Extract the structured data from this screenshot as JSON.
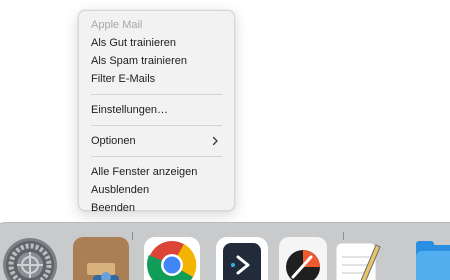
{
  "context_menu": {
    "header": "Apple Mail",
    "items": [
      {
        "label": "Als Gut trainieren"
      },
      {
        "label": "Als Spam trainieren"
      },
      {
        "label": "Filter E-Mails"
      },
      {
        "label": "Einstellungen…"
      },
      {
        "label": "Optionen"
      },
      {
        "label": "Alle Fenster anzeigen"
      },
      {
        "label": "Ausblenden"
      },
      {
        "label": "Beenden"
      }
    ]
  },
  "dock": {
    "apps": [
      {
        "icon": "system-settings-icon"
      },
      {
        "icon": "mail-app-icon"
      },
      {
        "icon": "chrome-icon"
      },
      {
        "icon": "send-to-app-icon"
      },
      {
        "icon": "rocket-typist-icon"
      },
      {
        "icon": "notes-pen-icon"
      },
      {
        "icon": "finder-folder-icon"
      }
    ]
  }
}
